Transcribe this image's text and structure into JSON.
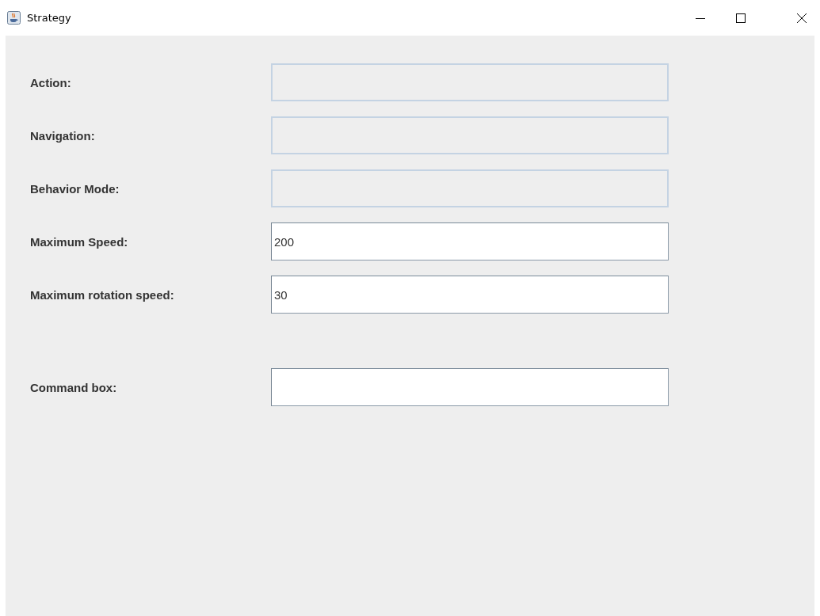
{
  "window": {
    "title": "Strategy"
  },
  "fields": [
    {
      "label": "Action:",
      "disabled": true
    },
    {
      "label": "Navigation:",
      "disabled": true
    },
    {
      "label": "Behavior Mode:",
      "disabled": true
    },
    {
      "label": "Maximum Speed:",
      "disabled": false,
      "value": "200"
    },
    {
      "label": "Maximum rotation speed:",
      "disabled": false,
      "value": "30"
    }
  ],
  "command": {
    "label": "Command box:",
    "disabled": false
  }
}
